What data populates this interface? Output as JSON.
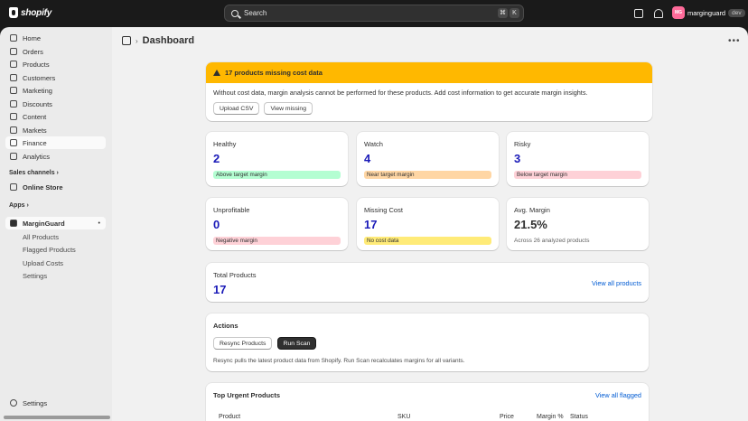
{
  "topbar": {
    "brand": "shopify",
    "search_placeholder": "Search",
    "shortcut_keys": [
      "⌘",
      "K"
    ],
    "avatar_text": "MG",
    "user_name": "marginguard",
    "badge": "dev"
  },
  "sidebar": {
    "items": [
      {
        "label": "Home"
      },
      {
        "label": "Orders"
      },
      {
        "label": "Products"
      },
      {
        "label": "Customers"
      },
      {
        "label": "Marketing"
      },
      {
        "label": "Discounts"
      },
      {
        "label": "Content"
      },
      {
        "label": "Markets"
      },
      {
        "label": "Finance"
      },
      {
        "label": "Analytics"
      }
    ],
    "sales_channels_label": "Sales channels",
    "online_store": "Online Store",
    "apps_label": "Apps",
    "app_name": "MarginGuard",
    "app_subitems": [
      "All Products",
      "Flagged Products",
      "Upload Costs",
      "Settings"
    ],
    "settings": "Settings"
  },
  "page": {
    "title": "Dashboard"
  },
  "banner": {
    "title": "17 products missing cost data",
    "message": "Without cost data, margin analysis cannot be performed for these products. Add cost information to get accurate margin insights.",
    "upload_button": "Upload CSV",
    "view_button": "View missing"
  },
  "stats": [
    {
      "label": "Healthy",
      "value": "2",
      "pill": "Above target margin",
      "color": "#b4fed2"
    },
    {
      "label": "Watch",
      "value": "4",
      "pill": "Near target margin",
      "color": "#ffd6a4"
    },
    {
      "label": "Risky",
      "value": "3",
      "pill": "Below target margin",
      "color": "#fed1d7"
    },
    {
      "label": "Unprofitable",
      "value": "0",
      "pill": "Negative margin",
      "color": "#fed1d7"
    },
    {
      "label": "Missing Cost",
      "value": "17",
      "pill": "No cost data",
      "color": "#ffeb78"
    },
    {
      "label": "Avg. Margin",
      "value": "21.5%",
      "sub": "Across 26 analyzed products"
    }
  ],
  "total": {
    "label": "Total Products",
    "value": "17",
    "link": "View all products"
  },
  "actions": {
    "title": "Actions",
    "resync_button": "Resync Products",
    "scan_button": "Run Scan",
    "note": "Resync pulls the latest product data from Shopify. Run Scan recalculates margins for all variants."
  },
  "urgent": {
    "title": "Top Urgent Products",
    "link": "View all flagged",
    "columns": [
      "Product",
      "SKU",
      "Price",
      "Margin %",
      "Status"
    ]
  }
}
